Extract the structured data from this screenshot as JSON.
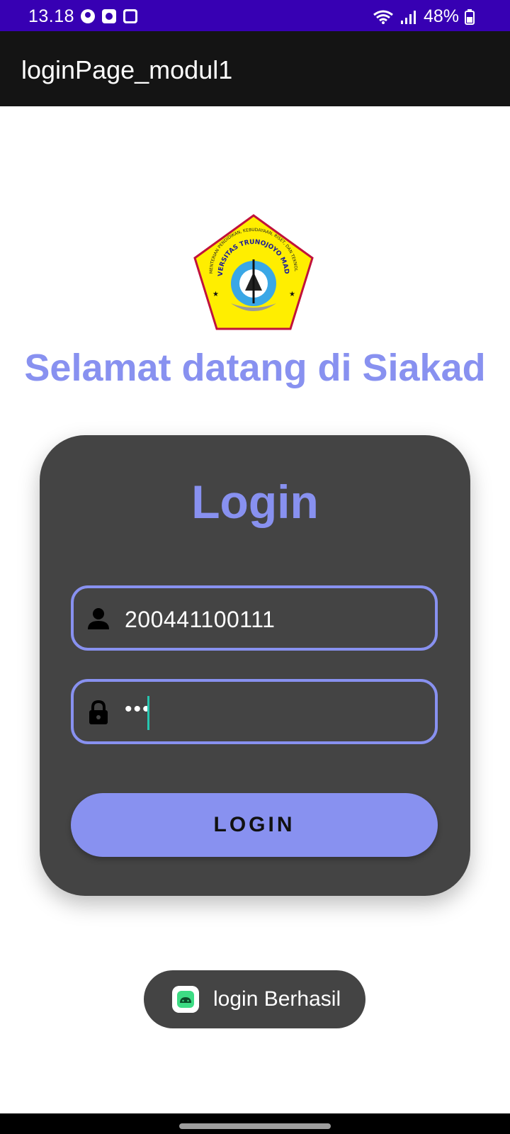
{
  "status_bar": {
    "time": "13.18",
    "battery": "48%",
    "icons": [
      "account-icon",
      "clock-icon",
      "gallery-icon",
      "wifi-icon",
      "signal-icon",
      "battery-icon"
    ]
  },
  "app_bar": {
    "title": "loginPage_modul1"
  },
  "logo": {
    "text_top": "KEMENTERIAN PENDIDIKAN, KEBUDAYAAN, RISET, DAN TEKNOLOGI",
    "text_name": "UNIVERSITAS TRUNOJOYO MADURA"
  },
  "welcome_text": "Selamat datang di Siakad",
  "login_card": {
    "title": "Login",
    "username_value": "200441100111",
    "password_value": "•••",
    "button_label": "LOGIN"
  },
  "toast": {
    "message": "login Berhasil"
  },
  "colors": {
    "status_bar": "#3700b3",
    "app_bar": "#141414",
    "accent": "#8891f0",
    "card": "#444444",
    "caret": "#26c6b0"
  }
}
